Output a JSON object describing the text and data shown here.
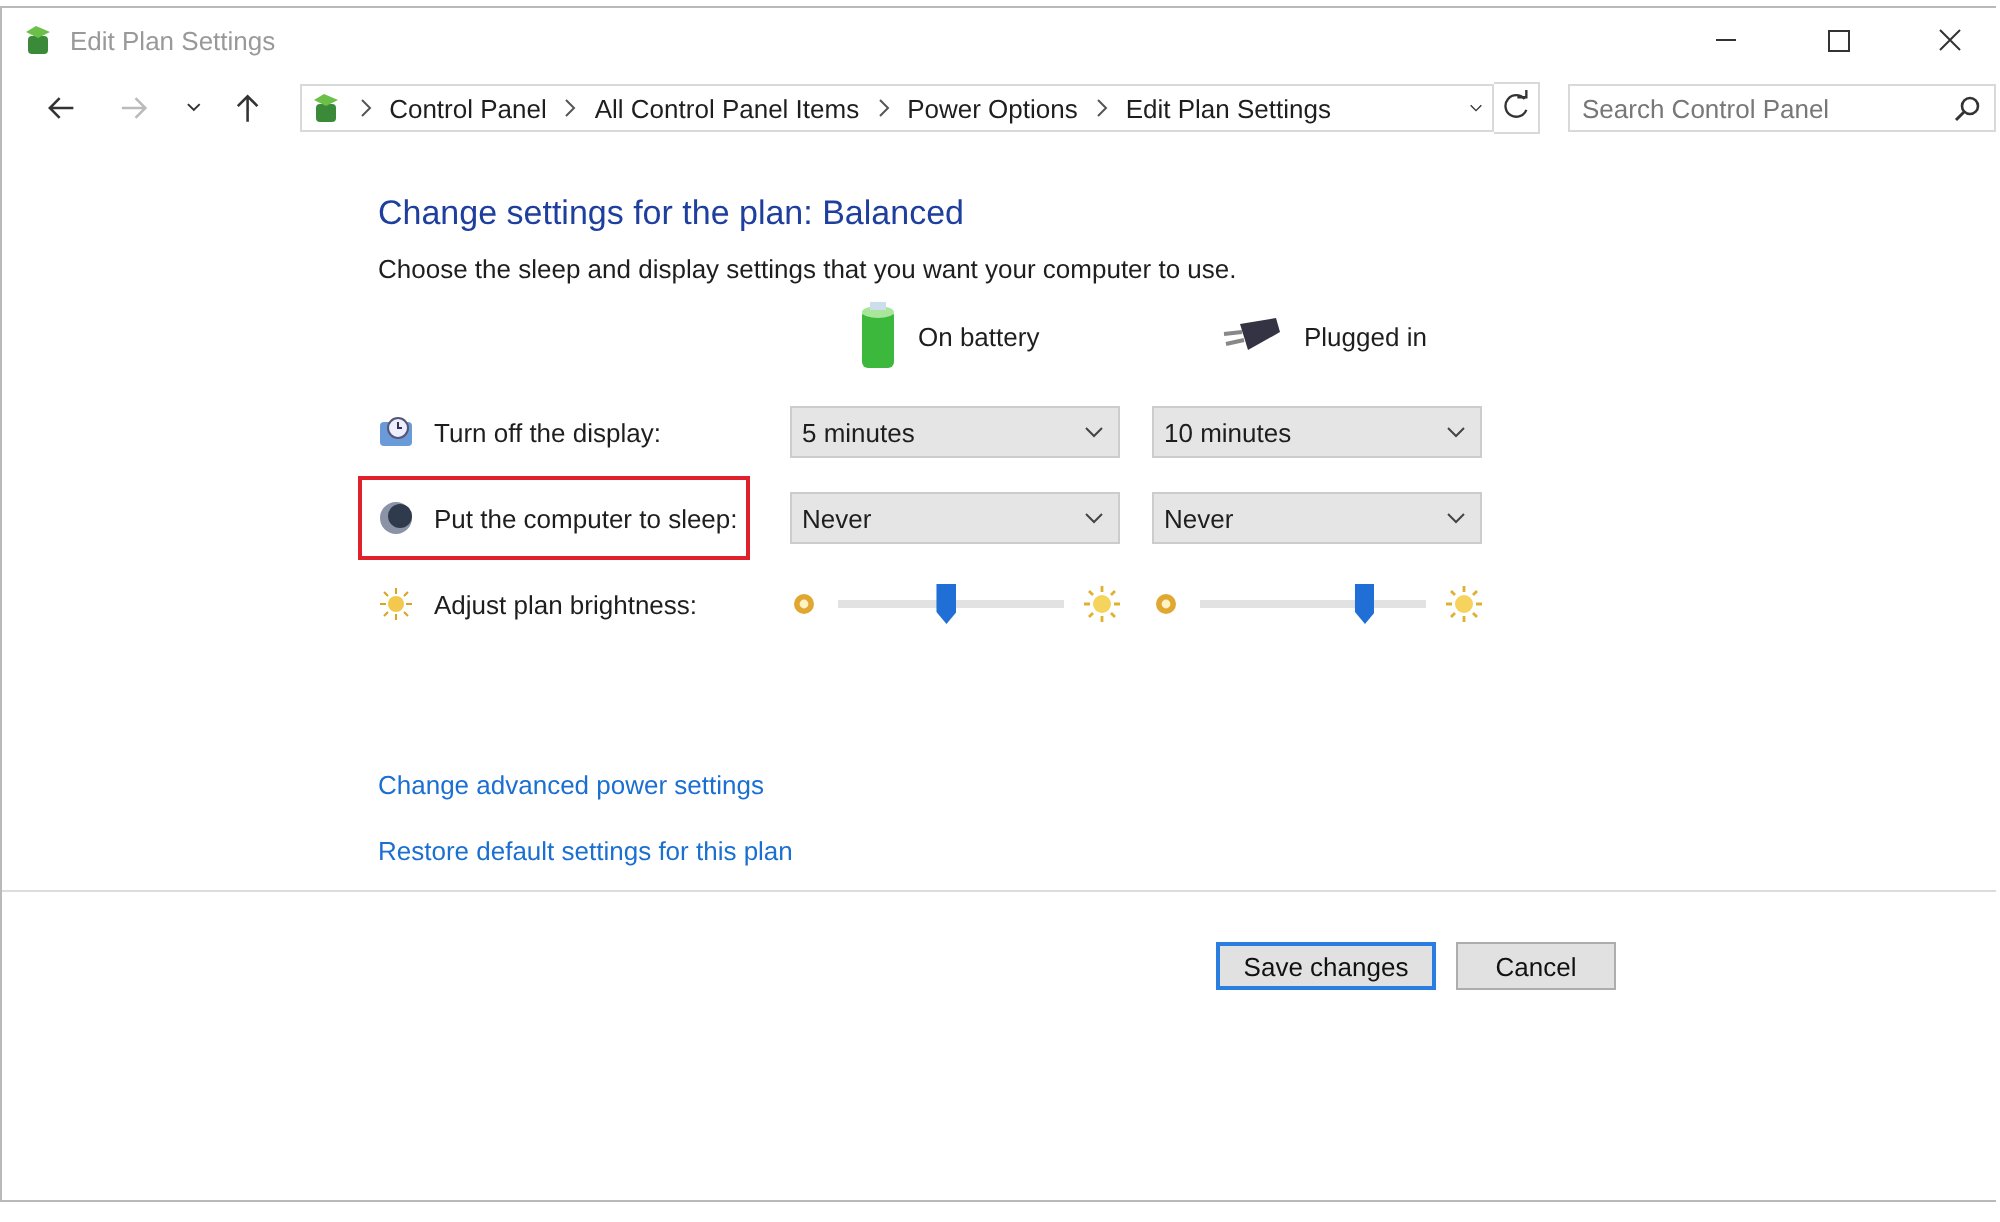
{
  "window": {
    "title": "Edit Plan Settings"
  },
  "address_bar": {
    "breadcrumbs": [
      "Control Panel",
      "All Control Panel Items",
      "Power Options",
      "Edit Plan Settings"
    ]
  },
  "search": {
    "placeholder": "Search Control Panel"
  },
  "heading": "Change settings for the plan: Balanced",
  "description": "Choose the sleep and display settings that you want your computer to use.",
  "columns": [
    {
      "label": "On battery",
      "kind": "battery"
    },
    {
      "label": "Plugged in",
      "kind": "plug"
    }
  ],
  "settings": [
    {
      "label": "Turn off the display:",
      "kind": "dropdown",
      "highlighted": false,
      "controls": [
        {
          "value": "5 minutes"
        },
        {
          "value": "10 minutes"
        }
      ]
    },
    {
      "label": "Put the computer to sleep:",
      "kind": "dropdown",
      "highlighted": true,
      "controls": [
        {
          "value": "Never"
        },
        {
          "value": "Never"
        }
      ]
    },
    {
      "label": "Adjust plan brightness:",
      "kind": "slider",
      "highlighted": false,
      "controls": [
        {
          "level": 0.48
        },
        {
          "level": 0.73
        }
      ]
    }
  ],
  "links": [
    "Change advanced power settings",
    "Restore default settings for this plan"
  ],
  "buttons": [
    {
      "label": "Save changes",
      "default": true
    },
    {
      "label": "Cancel",
      "default": false
    }
  ]
}
